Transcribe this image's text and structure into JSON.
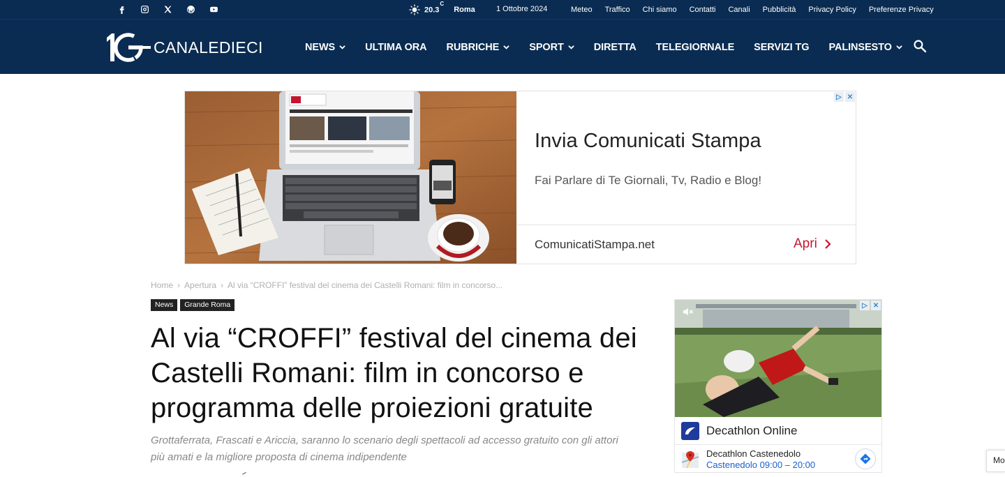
{
  "topbar": {
    "social_icons": [
      "facebook-icon",
      "instagram-icon",
      "x-icon",
      "wordpress-icon",
      "youtube-icon"
    ],
    "weather": {
      "temperature": "20.3",
      "unit": "C",
      "city": "Roma",
      "icon": "sun-icon"
    },
    "date": "1 Ottobre 2024",
    "links": [
      "Meteo",
      "Traffico",
      "Chi siamo",
      "Contatti",
      "Canali",
      "Pubblicità",
      "Privacy Policy",
      "Preferenze Privacy"
    ]
  },
  "header": {
    "logo_text": "CANALEDIECI",
    "nav": [
      {
        "label": "NEWS",
        "dropdown": true
      },
      {
        "label": "ULTIMA ORA",
        "dropdown": false
      },
      {
        "label": "RUBRICHE",
        "dropdown": true
      },
      {
        "label": "SPORT",
        "dropdown": true
      },
      {
        "label": "DIRETTA",
        "dropdown": false
      },
      {
        "label": "TELEGIORNALE",
        "dropdown": false
      },
      {
        "label": "SERVIZI TG",
        "dropdown": false
      },
      {
        "label": "PALINSESTO",
        "dropdown": true
      }
    ],
    "search_icon": "search-icon"
  },
  "ad_banner": {
    "headline": "Invia Comunicati Stampa",
    "subtitle": "Fai Parlare di Te Giornali, Tv, Radio e Blog!",
    "domain": "ComunicatiStampa.net",
    "cta": "Apri"
  },
  "article": {
    "breadcrumb": [
      "Home",
      "Apertura",
      "Al via “CROFFI” festival del cinema dei Castelli Romani: film in concorso..."
    ],
    "tags": [
      "News",
      "Grande Roma"
    ],
    "title": "Al via “CROFFI” festival del cinema dei Castelli Romani: film in concorso e programma delle proiezioni gratuite",
    "excerpt": "Grottaferrata, Frascati e Ariccia, saranno lo scenario degli spettacoli ad accesso gratuito con gli attori più amati e la migliore proposta di cinema indipendente"
  },
  "ad_side": {
    "advertiser": "Decathlon Online",
    "store_name": "Decathlon Castenedolo",
    "store_info": "Castenedolo 09:00 – 20:00"
  },
  "edge_widget": {
    "label": "Mo"
  },
  "colors": {
    "navy": "#0a2c52",
    "accent_red": "#c5152f",
    "link_blue": "#1a5fd0"
  }
}
